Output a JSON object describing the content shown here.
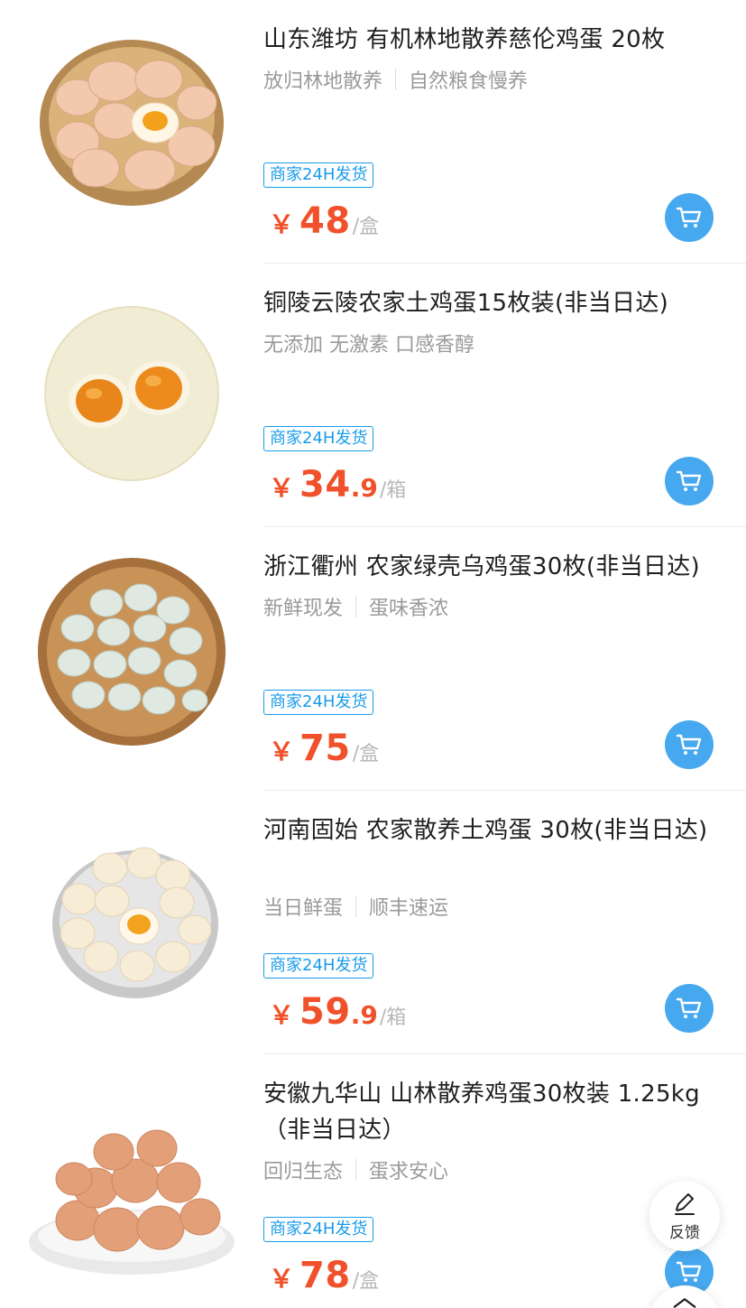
{
  "currency": "￥",
  "badge_text": "商家24H发货",
  "items": [
    {
      "title": "山东潍坊 有机林地散养慈伦鸡蛋 20枚",
      "tags": [
        "放归林地散养",
        "自然粮食慢养"
      ],
      "price_int": "48",
      "price_dec": "",
      "unit": "/盒",
      "image": "egg-basket-brown-icon"
    },
    {
      "title": "铜陵云陵农家土鸡蛋15枚装(非当日达)",
      "tags": [
        "无添加 无激素 口感香醇"
      ],
      "price_int": "34",
      "price_dec": ".9",
      "unit": "/箱",
      "image": "egg-yolks-plate-icon"
    },
    {
      "title": "浙江衢州 农家绿壳乌鸡蛋30枚(非当日达)",
      "tags": [
        "新鲜现发",
        "蛋味香浓"
      ],
      "price_int": "75",
      "price_dec": "",
      "unit": "/盒",
      "image": "green-eggs-basket-icon"
    },
    {
      "title": "河南固始 农家散养土鸡蛋 30枚(非当日达)",
      "tags": [
        "当日鲜蛋",
        "顺丰速运"
      ],
      "price_int": "59",
      "price_dec": ".9",
      "unit": "/箱",
      "image": "eggs-plate-yolk-icon"
    },
    {
      "title": "安徽九华山 山林散养鸡蛋30枚装 1.25kg（非当日达）",
      "tags": [
        "回归生态",
        "蛋求安心"
      ],
      "price_int": "78",
      "price_dec": "",
      "unit": "/盒",
      "image": "eggs-bowl-icon"
    }
  ],
  "feedback_label": "反馈",
  "colors": {
    "price": "#f0512a",
    "badge": "#1a9bea",
    "cart": "#46a8ee"
  }
}
